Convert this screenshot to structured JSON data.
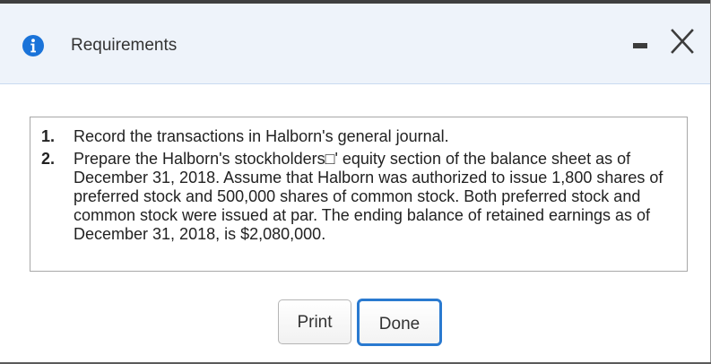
{
  "dialog": {
    "title": "Requirements",
    "icons": {
      "info": "info-icon",
      "minimize": "minimize-icon",
      "close": "close-icon"
    },
    "colors": {
      "header_bg": "#eef3fa",
      "info_icon": "#1a73d9",
      "done_border": "#2a7ad0"
    }
  },
  "requirements": [
    {
      "number": "1.",
      "text": "Record the transactions in Halborn's general journal."
    },
    {
      "number": "2.",
      "text": "Prepare the Halborn's stockholders□' equity section of the balance sheet as of December 31, 2018. Assume that Halborn was authorized to issue 1,800 shares of preferred stock and 500,000 shares of common stock. Both preferred stock and common stock were issued at par. The ending balance of retained earnings as of December 31, 2018, is $2,080,000."
    }
  ],
  "buttons": {
    "print_label": "Print",
    "done_label": "Done"
  }
}
